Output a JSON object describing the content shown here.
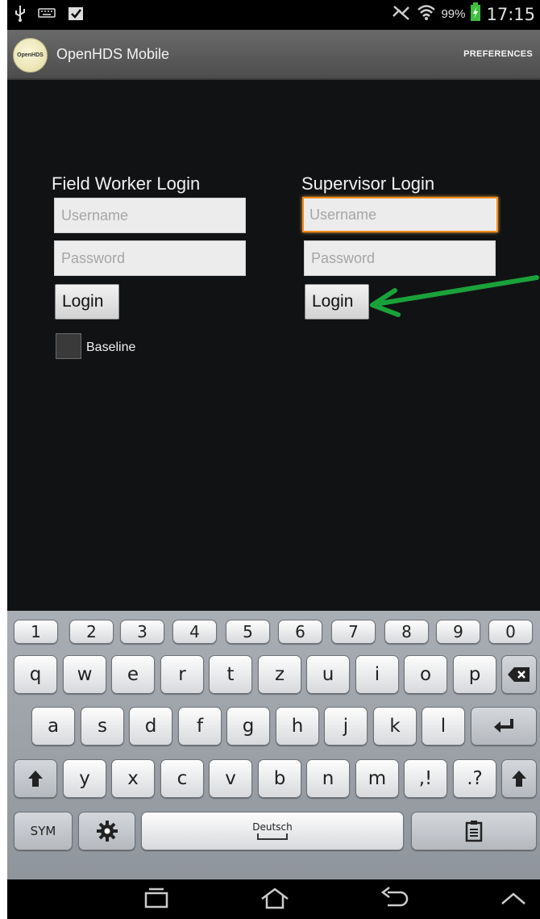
{
  "status_bar": {
    "battery_percent": "99%",
    "time": "17:15",
    "icons": [
      "usb-icon",
      "keyboard-icon",
      "clipboard-check-icon",
      "mute-icon",
      "wifi-icon",
      "battery-charging-icon"
    ]
  },
  "action_bar": {
    "logo_text": "OpenHDS",
    "title": "OpenHDS Mobile",
    "preferences_label": "PREFERENCES"
  },
  "field_worker": {
    "heading": "Field Worker Login",
    "username_placeholder": "Username",
    "password_placeholder": "Password",
    "login_label": "Login",
    "baseline_label": "Baseline"
  },
  "supervisor": {
    "heading": "Supervisor Login",
    "username_placeholder": "Username",
    "password_placeholder": "Password",
    "login_label": "Login"
  },
  "annotation": {
    "arrow_color": "#1aa23a"
  },
  "keyboard": {
    "numbers": [
      "1",
      "2",
      "3",
      "4",
      "5",
      "6",
      "7",
      "8",
      "9",
      "0"
    ],
    "row1": [
      "q",
      "w",
      "e",
      "r",
      "t",
      "z",
      "u",
      "i",
      "o",
      "p"
    ],
    "row2": [
      "a",
      "s",
      "d",
      "f",
      "g",
      "h",
      "j",
      "k",
      "l"
    ],
    "row3": [
      "y",
      "x",
      "c",
      "v",
      "b",
      "n",
      "m"
    ],
    "punct1": ",!",
    "punct2": ".?",
    "sym_label": "SYM",
    "space_label": "Deutsch"
  },
  "colors": {
    "focus_border": "#f08d1e",
    "background": "#111214"
  }
}
